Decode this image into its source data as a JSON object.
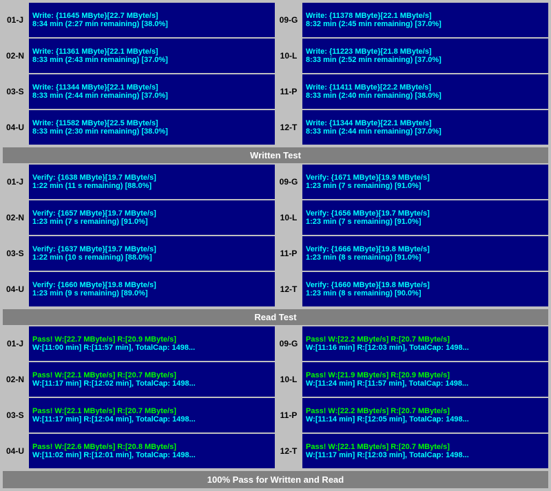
{
  "sections": {
    "written_test": {
      "label": "Written Test",
      "left_devices": [
        {
          "id": "01-J",
          "line1": "Write: {11645 MByte}[22.7 MByte/s]",
          "line2": "8:34 min (2:27 min remaining)  [38.0%]"
        },
        {
          "id": "02-N",
          "line1": "Write: {11361 MByte}[22.1 MByte/s]",
          "line2": "8:33 min (2:43 min remaining)  [37.0%]"
        },
        {
          "id": "03-S",
          "line1": "Write: {11344 MByte}[22.1 MByte/s]",
          "line2": "8:33 min (2:44 min remaining)  [37.0%]"
        },
        {
          "id": "04-U",
          "line1": "Write: {11582 MByte}[22.5 MByte/s]",
          "line2": "8:33 min (2:30 min remaining)  [38.0%]"
        }
      ],
      "right_devices": [
        {
          "id": "09-G",
          "line1": "Write: {11378 MByte}[22.1 MByte/s]",
          "line2": "8:32 min (2:45 min remaining)  [37.0%]"
        },
        {
          "id": "10-L",
          "line1": "Write: {11223 MByte}[21.8 MByte/s]",
          "line2": "8:33 min (2:52 min remaining)  [37.0%]"
        },
        {
          "id": "11-P",
          "line1": "Write: {11411 MByte}[22.2 MByte/s]",
          "line2": "8:33 min (2:40 min remaining)  [38.0%]"
        },
        {
          "id": "12-T",
          "line1": "Write: {11344 MByte}[22.1 MByte/s]",
          "line2": "8:33 min (2:44 min remaining)  [37.0%]"
        }
      ]
    },
    "verify_test": {
      "label": "Written Test",
      "left_devices": [
        {
          "id": "01-J",
          "line1": "Verify: {1638 MByte}[19.7 MByte/s]",
          "line2": "1:22 min (11 s remaining)  [88.0%]"
        },
        {
          "id": "02-N",
          "line1": "Verify: {1657 MByte}[19.7 MByte/s]",
          "line2": "1:23 min (7 s remaining)  [91.0%]"
        },
        {
          "id": "03-S",
          "line1": "Verify: {1637 MByte}[19.7 MByte/s]",
          "line2": "1:22 min (10 s remaining)  [88.0%]"
        },
        {
          "id": "04-U",
          "line1": "Verify: {1660 MByte}[19.8 MByte/s]",
          "line2": "1:23 min (9 s remaining)  [89.0%]"
        }
      ],
      "right_devices": [
        {
          "id": "09-G",
          "line1": "Verify: {1671 MByte}[19.9 MByte/s]",
          "line2": "1:23 min (7 s remaining)  [91.0%]"
        },
        {
          "id": "10-L",
          "line1": "Verify: {1656 MByte}[19.7 MByte/s]",
          "line2": "1:23 min (7 s remaining)  [91.0%]"
        },
        {
          "id": "11-P",
          "line1": "Verify: {1666 MByte}[19.8 MByte/s]",
          "line2": "1:23 min (8 s remaining)  [91.0%]"
        },
        {
          "id": "12-T",
          "line1": "Verify: {1660 MByte}[19.8 MByte/s]",
          "line2": "1:23 min (8 s remaining)  [90.0%]"
        }
      ]
    },
    "read_test": {
      "label": "Read Test",
      "left_devices": [
        {
          "id": "01-J",
          "line1": "Pass! W:[22.7 MByte/s] R:[20.9 MByte/s]",
          "line2": "W:[11:00 min] R:[11:57 min], TotalCap: 1498..."
        },
        {
          "id": "02-N",
          "line1": "Pass! W:[22.1 MByte/s] R:[20.7 MByte/s]",
          "line2": "W:[11:17 min] R:[12:02 min], TotalCap: 1498..."
        },
        {
          "id": "03-S",
          "line1": "Pass! W:[22.1 MByte/s] R:[20.7 MByte/s]",
          "line2": "W:[11:17 min] R:[12:04 min], TotalCap: 1498..."
        },
        {
          "id": "04-U",
          "line1": "Pass! W:[22.6 MByte/s] R:[20.8 MByte/s]",
          "line2": "W:[11:02 min] R:[12:01 min], TotalCap: 1498..."
        }
      ],
      "right_devices": [
        {
          "id": "09-G",
          "line1": "Pass! W:[22.2 MByte/s] R:[20.7 MByte/s]",
          "line2": "W:[11:16 min] R:[12:03 min], TotalCap: 1498..."
        },
        {
          "id": "10-L",
          "line1": "Pass! W:[21.9 MByte/s] R:[20.9 MByte/s]",
          "line2": "W:[11:24 min] R:[11:57 min], TotalCap: 1498..."
        },
        {
          "id": "11-P",
          "line1": "Pass! W:[22.2 MByte/s] R:[20.7 MByte/s]",
          "line2": "W:[11:14 min] R:[12:05 min], TotalCap: 1498..."
        },
        {
          "id": "12-T",
          "line1": "Pass! W:[22.1 MByte/s] R:[20.7 MByte/s]",
          "line2": "W:[11:17 min] R:[12:03 min], TotalCap: 1498..."
        }
      ]
    }
  },
  "footer": {
    "label": "100% Pass for Written and Read"
  }
}
